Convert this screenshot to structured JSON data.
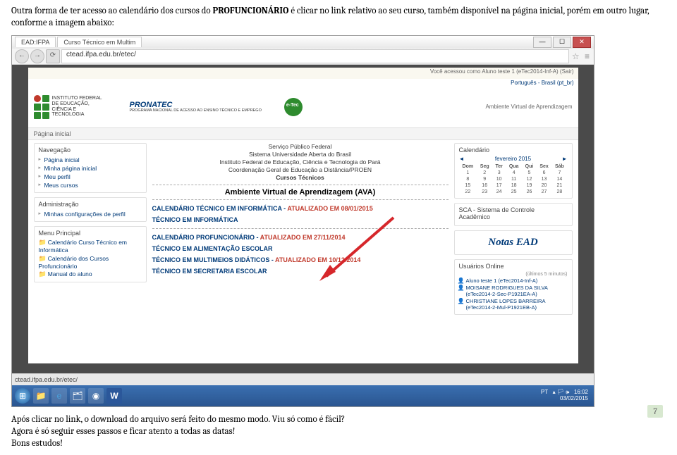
{
  "instruction": {
    "pre": "Outra forma de ter acesso ao calendário dos cursos do ",
    "bold": "PROFUNCIONÁRIO",
    "post": " é clicar no link relativo ao seu curso, também disponível na página inicial, porém em outro lugar, conforme a imagem abaixo:"
  },
  "browser": {
    "tab1": "EAD:IFPA",
    "tab2": "Curso Técnico em Multim",
    "url": "ctead.ifpa.edu.br/etec/",
    "status": "ctead.ifpa.edu.br/etec/"
  },
  "page": {
    "topbar": "Você acessou como Aluno teste 1 (eTec2014-Inf-A)  (Sair)",
    "lang": "Português - Brasil (pt_br)",
    "if_text": "INSTITUTO FEDERAL DE EDUCAÇÃO, CIÊNCIA E TECNOLOGIA",
    "pronatec": "PRONATEC",
    "pronatec_sub": "PROGRAMA NACIONAL DE ACESSO AO ENSINO TÉCNICO E EMPREGO",
    "header_sub": "Ambiente Virtual de Aprendizagem",
    "crumb": "Página inicial",
    "nav": {
      "title": "Navegação",
      "items": [
        "Página inicial",
        "Minha página inicial",
        "Meu perfil",
        "Meus cursos"
      ]
    },
    "admin": {
      "title": "Administração",
      "items": [
        "Minhas configurações de perfil"
      ]
    },
    "menu": {
      "title": "Menu Principal",
      "items": [
        "Calendário Curso Técnico em Informática",
        "Calendário dos Cursos Profuncionário",
        "Manual do aluno"
      ]
    },
    "center": {
      "l1": "Serviço Público Federal",
      "l2": "Sistema Universidade Aberta do Brasil",
      "l3": "Instituto Federal de Educação, Ciência e Tecnologia do Pará",
      "l4": "Coordenação Geral de Educação a Distância/PROEN",
      "l5": "Cursos Técnicos",
      "ava": "Ambiente Virtual de Aprendizagem (AVA)",
      "cal_info": "CALENDÁRIO TÉCNICO EM INFORMÁTICA - ",
      "cal_info_upd": "ATUALIZADO EM 08/01/2015",
      "tec_info": "TÉCNICO EM INFORMÁTICA",
      "cal_prof": "CALENDÁRIO PROFUNCIONÁRIO - ",
      "cal_prof_upd": "ATUALIZADO EM 27/11/2014",
      "tec_alim": "TÉCNICO EM ALIMENTAÇÃO ESCOLAR",
      "tec_mult": "TÉCNICO EM MULTIMEIOS DIDÁTICOS - ",
      "tec_mult_upd": "ATUALIZADO EM 10/12/2014",
      "tec_sec": "TÉCNICO EM SECRETARIA ESCOLAR"
    },
    "calendar": {
      "title": "Calendário",
      "month": "fevereiro 2015",
      "dow": [
        "Dom",
        "Seg",
        "Ter",
        "Qua",
        "Qui",
        "Sex",
        "Sáb"
      ],
      "weeks": [
        [
          "1",
          "2",
          "3",
          "4",
          "5",
          "6",
          "7"
        ],
        [
          "8",
          "9",
          "10",
          "11",
          "12",
          "13",
          "14"
        ],
        [
          "15",
          "16",
          "17",
          "18",
          "19",
          "20",
          "21"
        ],
        [
          "22",
          "23",
          "24",
          "25",
          "26",
          "27",
          "28"
        ]
      ]
    },
    "sca": "SCA - Sistema de Controle Acadêmico",
    "notas": "Notas EAD",
    "online": {
      "title": "Usuários Online",
      "sub": "(últimos 5 minutos)",
      "u1": "Aluno teste 1 (eTec2014-Inf-A)",
      "u2": "MOISANE RODRIGUES DA SILVA (eTec2014-2-Sec-P1921EA-A)",
      "u3": "CHRISTIANE LOPES BARREIRA (eTec2014-2-Mul-P1921EB-A)"
    }
  },
  "taskbar": {
    "lang": "PT",
    "time": "16:02",
    "date": "03/02/2015"
  },
  "closing": {
    "p1": "Após clicar no link, o download do arquivo será feito do mesmo modo. Viu só como é fácil?",
    "p2": "Agora é só seguir esses passos e ficar atento a todas as datas!",
    "p3": "Bons estudos!"
  },
  "page_num": "7"
}
